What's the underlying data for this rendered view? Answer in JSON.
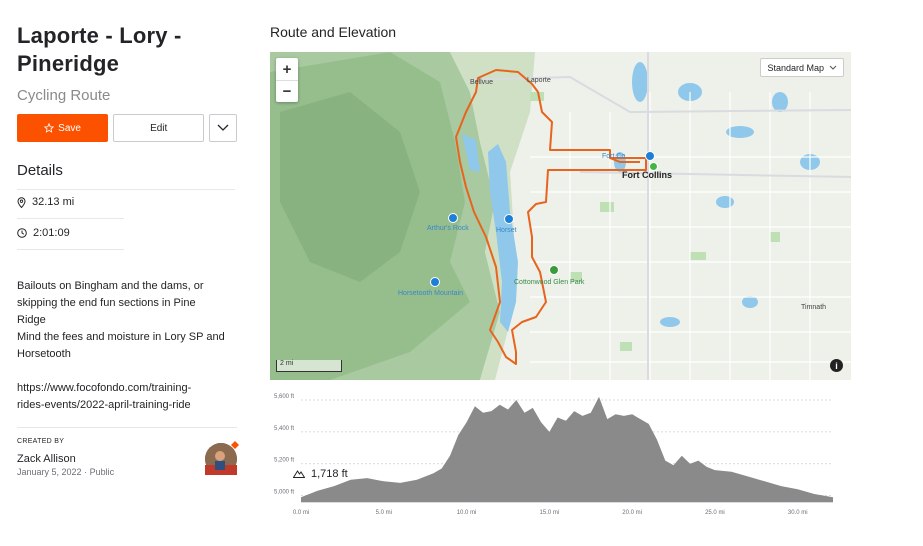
{
  "route": {
    "title_line1": "Laporte - Lory -",
    "title_line2": "Pineridge",
    "subtitle": "Cycling Route"
  },
  "actions": {
    "save_label": "Save",
    "edit_label": "Edit"
  },
  "details": {
    "heading": "Details",
    "distance": "32.13 mi",
    "elevation_gain": "1,718 ft",
    "time": "2:01:09"
  },
  "description": {
    "line1": "Bailouts on Bingham and the dams, or",
    "line2": "skipping the end fun sections in Pine",
    "line3": "Ridge",
    "line4": "Mind the fees and moisture in Lory SP and",
    "line5": "Horsetooth",
    "link_line1": "https://www.focofondo.com/training-",
    "link_line2": "rides-events/2022-april-training-ride"
  },
  "creator": {
    "label": "CREATED BY",
    "name": "Zack Allison",
    "date": "January 5, 2022",
    "separator": "·",
    "visibility": "Public"
  },
  "section_title": "Route and Elevation",
  "map": {
    "zoom_in": "+",
    "zoom_out": "−",
    "style_label": "Standard Map",
    "scale_label": "2 mi",
    "info": "i",
    "labels": {
      "bellvue": "Bellvue",
      "laporte": "Laporte",
      "fort_collins": "Fort Collins",
      "fort_collins_small": "Fort Co",
      "arthurs_rock": "Arthur's Rock",
      "horsetooth_mountain": "Horsetooth Mountain",
      "cottonwood_glen": "Cottonwood Glen Park",
      "timnath": "Timnath",
      "horsetooth_res": "Horset"
    },
    "route_color": "#e8641e"
  },
  "chart_data": {
    "type": "area",
    "title": "",
    "xlabel": "",
    "ylabel": "",
    "x_ticks": [
      "0.0 mi",
      "5.0 mi",
      "10.0 mi",
      "15.0 mi",
      "20.0 mi",
      "25.0 mi",
      "30.0 mi"
    ],
    "y_ticks": [
      "5,000 ft",
      "5,200 ft",
      "5,400 ft",
      "5,600 ft"
    ],
    "xlim": [
      0,
      32.13
    ],
    "ylim": [
      4960,
      5650
    ],
    "grid": true,
    "series": [
      {
        "x": [
          0,
          1,
          2,
          3,
          4,
          5,
          6,
          7,
          8,
          8.5,
          9,
          9.5,
          10,
          10.5,
          11,
          11.5,
          12,
          12.5,
          13,
          13.5,
          14,
          14.5,
          15,
          15.5,
          16,
          16.5,
          17,
          17.5,
          18,
          18.5,
          19,
          19.5,
          20,
          20.5,
          21,
          21.5,
          22,
          22.5,
          23,
          23.5,
          24,
          24.5,
          25,
          26,
          27,
          28,
          29,
          30,
          31,
          32.13
        ],
        "values": [
          4990,
          5030,
          5060,
          5100,
          5110,
          5090,
          5080,
          5100,
          5140,
          5170,
          5250,
          5380,
          5460,
          5560,
          5520,
          5530,
          5570,
          5540,
          5600,
          5520,
          5550,
          5460,
          5400,
          5490,
          5470,
          5530,
          5500,
          5520,
          5620,
          5480,
          5510,
          5500,
          5510,
          5480,
          5450,
          5350,
          5220,
          5190,
          5250,
          5200,
          5220,
          5180,
          5160,
          5150,
          5120,
          5090,
          5060,
          5040,
          5010,
          4990
        ]
      }
    ],
    "fill_color": "#8a8a8a"
  }
}
